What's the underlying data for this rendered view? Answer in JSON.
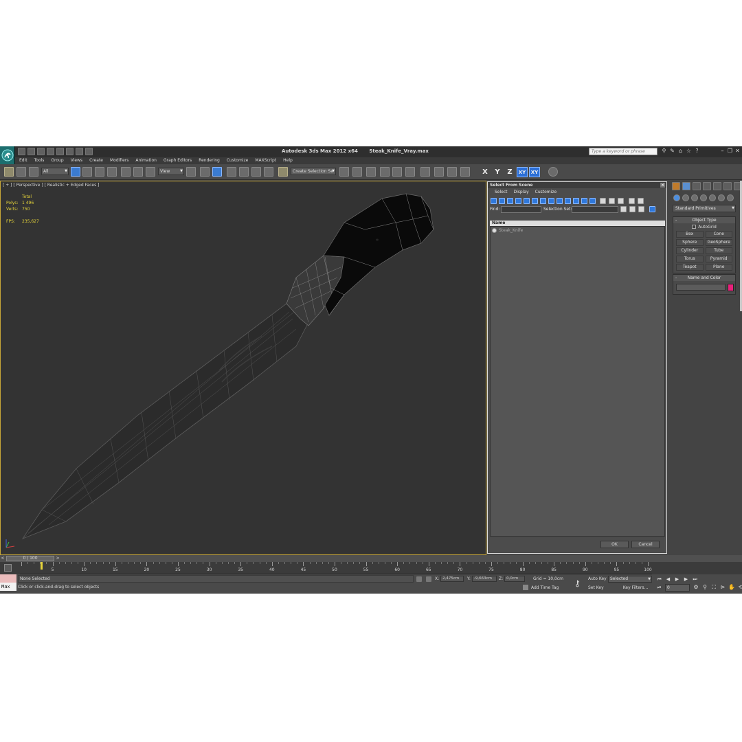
{
  "window": {
    "app_title": "Autodesk 3ds Max  2012 x64",
    "file_name": "Steak_Knife_Vray.max",
    "search_placeholder": "Type a keyword or phrase"
  },
  "menu": [
    "Edit",
    "Tools",
    "Group",
    "Views",
    "Create",
    "Modifiers",
    "Animation",
    "Graph Editors",
    "Rendering",
    "Customize",
    "MAXScript",
    "Help"
  ],
  "toolbar": {
    "filter_dropdown": "All",
    "reference_dropdown": "View",
    "selection_set_dropdown": "Create Selection Se",
    "axis_x": "X",
    "axis_y": "Y",
    "axis_z": "Z",
    "axis_xy": "XY",
    "axis_xy2": "XY"
  },
  "viewport": {
    "label": "[ + ] [ Perspective ] [ Realistic + Edged Faces ]",
    "stats": {
      "header": "Total",
      "polys_label": "Polys:",
      "polys_value": "1 496",
      "verts_label": "Verts:",
      "verts_value": "750",
      "fps_label": "FPS:",
      "fps_value": "235,627"
    }
  },
  "select_dialog": {
    "title": "Select From Scene",
    "menu": [
      "Select",
      "Display",
      "Customize"
    ],
    "find_label": "Find:",
    "selection_set_label": "Selection Set:",
    "column_name": "Name",
    "items": [
      "Steak_Knife"
    ],
    "ok_label": "OK",
    "cancel_label": "Cancel"
  },
  "command_panel": {
    "dropdown": "Standard Primitives",
    "object_type_title": "Object Type",
    "autogrid_label": "AutoGrid",
    "primitives": [
      "Box",
      "Cone",
      "Sphere",
      "GeoSphere",
      "Cylinder",
      "Tube",
      "Torus",
      "Pyramid",
      "Teapot",
      "Plane"
    ],
    "name_color_title": "Name and Color",
    "object_color": "#e8207a"
  },
  "timeline": {
    "frame_display": "0 / 100",
    "ticks": [
      "5",
      "10",
      "15",
      "20",
      "25",
      "30",
      "35",
      "40",
      "45",
      "50",
      "55",
      "60",
      "65",
      "70",
      "75",
      "80",
      "85",
      "90",
      "95",
      "100"
    ]
  },
  "status": {
    "maxscript_label": "Max",
    "selection_status": "None Selected",
    "prompt": "Click or click-and-drag to select objects",
    "x_label": "X:",
    "x_value": "2,475cm",
    "y_label": "Y:",
    "y_value": "-9,663cm",
    "z_label": "Z:",
    "z_value": "0,0cm",
    "grid": "Grid = 10,0cm",
    "add_time_tag": "Add Time Tag",
    "auto_key": "Auto Key",
    "set_key": "Set Key",
    "selected_dropdown": "Selected",
    "key_filters": "Key Filters...",
    "current_frame": "0"
  }
}
